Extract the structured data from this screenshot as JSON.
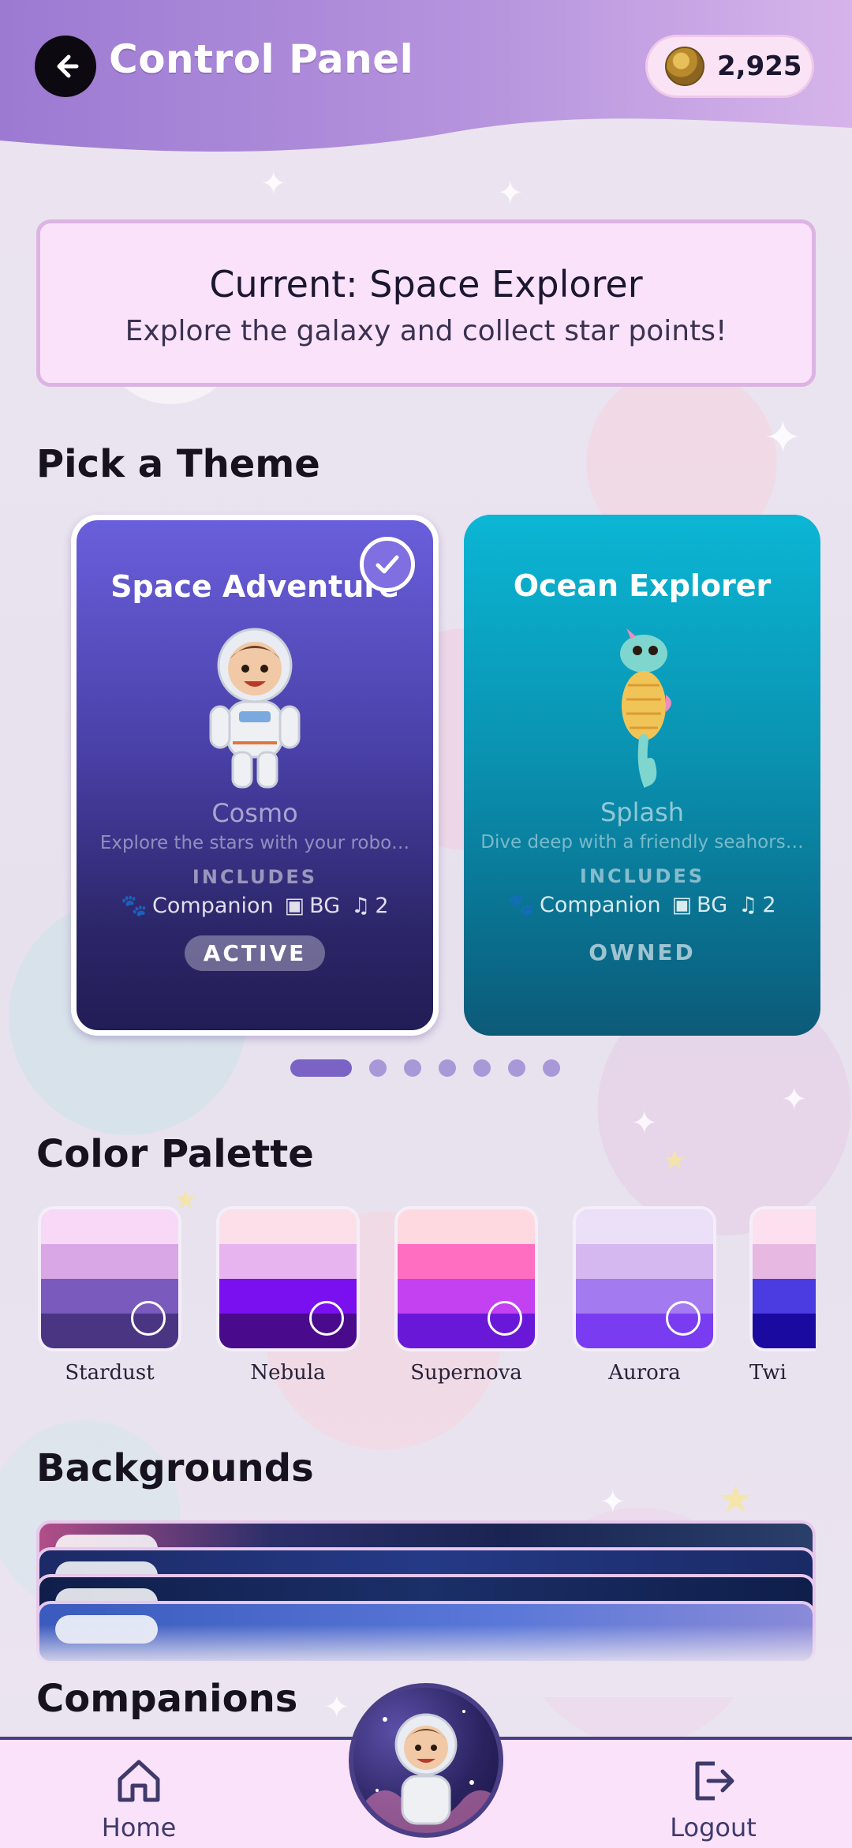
{
  "header": {
    "title": "Control Panel",
    "coins": "2,925"
  },
  "current": {
    "title": "Current: Space Explorer",
    "subtitle": "Explore the galaxy and collect star points!"
  },
  "sections": {
    "themes": "Pick a Theme",
    "palette": "Color Palette",
    "backgrounds": "Backgrounds",
    "companions": "Companions"
  },
  "themes": [
    {
      "name": "Space Adventure",
      "companion": "Cosmo",
      "description": "Explore the stars with your robo…",
      "includes_label": "INCLUDES",
      "companion_label": "Companion",
      "bg_label": "BG",
      "music_count": "2",
      "status": "ACTIVE",
      "selected": true
    },
    {
      "name": "Ocean Explorer",
      "companion": "Splash",
      "description": "Dive deep with a friendly seahors…",
      "includes_label": "INCLUDES",
      "companion_label": "Companion",
      "bg_label": "BG",
      "music_count": "2",
      "status": "OWNED",
      "selected": false
    }
  ],
  "carousel": {
    "total": 7,
    "active_index": 0
  },
  "palettes": [
    {
      "name": "Stardust",
      "colors": [
        "#f7d8f6",
        "#d9a6e6",
        "#7a5bbd",
        "#4a3583"
      ]
    },
    {
      "name": "Nebula",
      "colors": [
        "#fbe0ea",
        "#e8b4f0",
        "#7a10f0",
        "#4a0a8c"
      ]
    },
    {
      "name": "Supernova",
      "colors": [
        "#ffd9e0",
        "#ff6ec0",
        "#c341f0",
        "#6a18d8"
      ]
    },
    {
      "name": "Aurora",
      "colors": [
        "#ebe0f8",
        "#d5b8f0",
        "#a47af0",
        "#7a3cf0"
      ]
    },
    {
      "name": "Twi",
      "colors": [
        "#fde0ef",
        "#e6b8e2",
        "#4a3ce0",
        "#1a0aa0"
      ]
    }
  ],
  "nav": {
    "home": "Home",
    "logout": "Logout"
  },
  "colors": {
    "accent": "#7a63c4",
    "nav_border": "#4a3f86"
  },
  "icons": [
    "back-arrow-icon",
    "coin-icon",
    "check-icon",
    "paw-icon",
    "image-icon",
    "music-icon",
    "home-icon",
    "logout-icon"
  ]
}
